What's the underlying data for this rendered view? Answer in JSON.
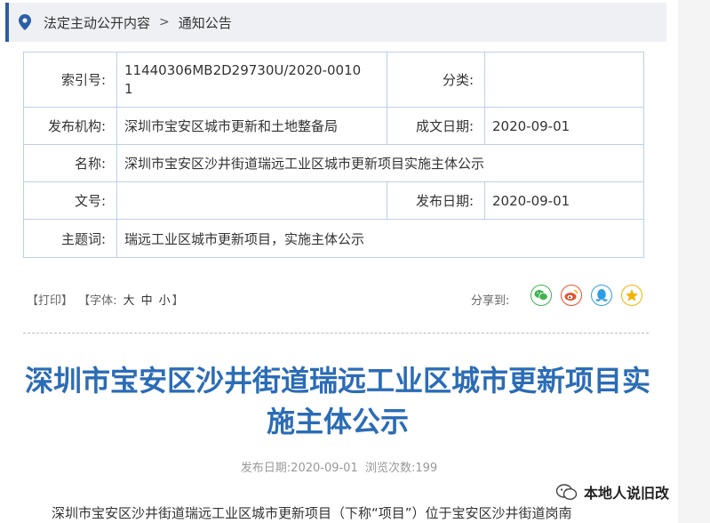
{
  "breadcrumb": {
    "item1": "法定主动公开内容",
    "item2": "通知公告"
  },
  "meta": {
    "index_label": "索引号:",
    "index_value_line1": "11440306MB2D29730U/2020-0010",
    "index_value_line2": "1",
    "category_label": "分类:",
    "category_value": "",
    "issuer_label": "发布机构:",
    "issuer_value": "深圳市宝安区城市更新和土地整备局",
    "written_date_label": "成文日期:",
    "written_date_value": "2020-09-01",
    "name_label": "名称:",
    "name_value": "深圳市宝安区沙井街道瑞远工业区城市更新项目实施主体公示",
    "doc_no_label": "文号:",
    "doc_no_value": "",
    "publish_date_label": "发布日期:",
    "publish_date_value": "2020-09-01",
    "subject_label": "主题词:",
    "subject_value": "瑞远工业区城市更新项目，实施主体公示"
  },
  "toolbar": {
    "print": "【打印】",
    "font_open": "【字体:",
    "font_large": "大",
    "font_medium": "中",
    "font_small": "小",
    "font_close": "】",
    "share_label": "分享到:",
    "share_icons": [
      "wechat-icon",
      "weibo-icon",
      "qq-icon",
      "qzone-icon"
    ],
    "colors": {
      "wechat": "#3fb34f",
      "weibo": "#e6512e",
      "qq": "#2c9ee8",
      "qzone": "#f2b400"
    }
  },
  "article": {
    "title_line1": "深圳市宝安区沙井街道瑞远工业区城市更新项目实",
    "title_line2": "施主体公示",
    "publish_date_label": "发布日期:",
    "publish_date": "2020-09-01",
    "views_label": "浏览次数:",
    "views": "199",
    "body_first_line": "深圳市宝安区沙井街道瑞远工业区城市更新项目（下称“项目”）位于宝安区沙井街道岗南"
  },
  "watermark": {
    "text": "本地人说旧改"
  },
  "colors": {
    "accent": "#2b5ea8",
    "title": "#2b6cb6",
    "table_border": "#bcd0e8"
  }
}
